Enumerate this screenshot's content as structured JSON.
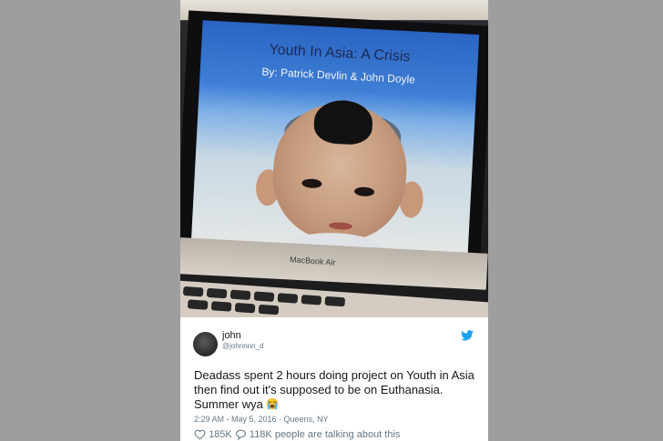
{
  "photo": {
    "slide_title": "Youth In Asia: A Crisis",
    "slide_subtitle": "By: Patrick Devlin & John Doyle",
    "laptop_label": "MacBook Air"
  },
  "tweet": {
    "name": "john",
    "handle": "@johnnnn_d",
    "text": "Deadass spent 2 hours doing project on Youth in Asia then find out it's supposed to be on Euthanasia. Summer wya",
    "emoji_icon": "loudly-crying-face-icon",
    "timestamp": "2:29 AM - May 5, 2016 · Queens, NY",
    "likes": "185K",
    "talking": "118K people are talking about this",
    "brand_color": "#1da1f2"
  }
}
